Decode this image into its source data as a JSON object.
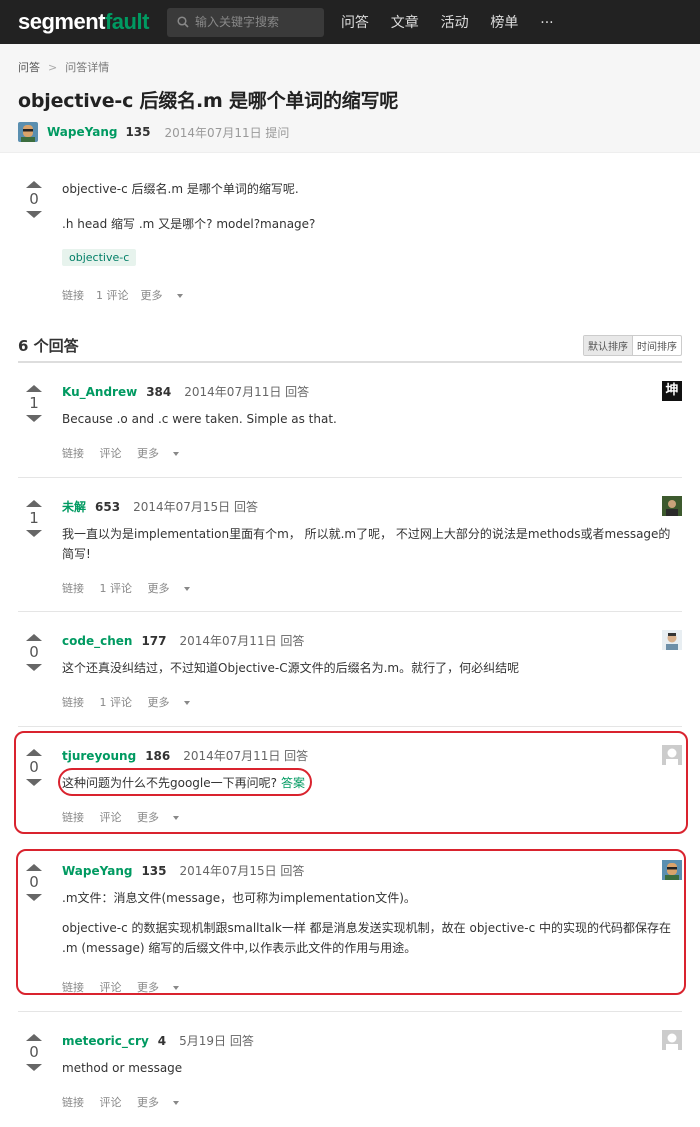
{
  "header": {
    "logo_a": "segment",
    "logo_b": "fault",
    "search_placeholder": "输入关键字搜索",
    "nav": [
      "问答",
      "文章",
      "活动",
      "榜单",
      "···"
    ]
  },
  "breadcrumb": {
    "home": "问答",
    "sep": ">",
    "current": "问答详情"
  },
  "question": {
    "title": "objective-c 后缀名.m 是哪个单词的缩写呢",
    "author": "WapeYang",
    "rep": "135",
    "time": "2014年07月11日 提问",
    "votes": "0",
    "body_line1": "objective-c 后缀名.m 是哪个单词的缩写呢.",
    "body_line2": ".h head 缩写 .m 又是哪个? model?manage?",
    "tag": "objective-c",
    "action_link": "链接",
    "action_comment": "1 评论",
    "action_more": "更多"
  },
  "answers_header": {
    "count": "6 个回答",
    "sort_default": "默认排序",
    "sort_time": "时间排序"
  },
  "answers": [
    {
      "author": "Ku_Andrew",
      "rep": "384",
      "time": "2014年07月11日 回答",
      "votes": "1",
      "body": [
        "Because .o and .c were taken. Simple as that."
      ],
      "link": "链接",
      "comment": "评论",
      "more": "更多",
      "avatar_text": "坤"
    },
    {
      "author": "未解",
      "rep": "653",
      "time": "2014年07月15日 回答",
      "votes": "1",
      "body": [
        "我一直以为是implementation里面有个m， 所以就.m了呢， 不过网上大部分的说法是methods或者message的简写!"
      ],
      "link": "链接",
      "comment": "1 评论",
      "more": "更多"
    },
    {
      "author": "code_chen",
      "rep": "177",
      "time": "2014年07月11日 回答",
      "votes": "0",
      "body": [
        "这个还真没纠结过，不过知道Objective-C源文件的后缀名为.m。就行了，何必纠结呢"
      ],
      "link": "链接",
      "comment": "1 评论",
      "more": "更多"
    },
    {
      "author": "tjureyoung",
      "rep": "186",
      "time": "2014年07月11日 回答",
      "votes": "0",
      "body": [
        "这种问题为什么不先google一下再问呢?"
      ],
      "body_link": "答案",
      "link": "链接",
      "comment": "评论",
      "more": "更多"
    },
    {
      "author": "WapeYang",
      "rep": "135",
      "time": "2014年07月15日 回答",
      "votes": "0",
      "body": [
        ".m文件：消息文件(message，也可称为implementation文件)。",
        "objective-c 的数据实现机制跟smalltalk一样 都是消息发送实现机制，故在 objective-c 中的实现的代码都保存在 .m (message) 缩写的后缀文件中,以作表示此文件的作用与用途。"
      ],
      "link": "链接",
      "comment": "评论",
      "more": "更多"
    },
    {
      "author": "meteoric_cry",
      "rep": "4",
      "time": "5月19日 回答",
      "votes": "0",
      "body": [
        "method or message"
      ],
      "link": "链接",
      "comment": "评论",
      "more": "更多"
    }
  ],
  "colors": {
    "accent": "#009a61",
    "highlight": "#d9232e",
    "topbar": "#222222"
  }
}
